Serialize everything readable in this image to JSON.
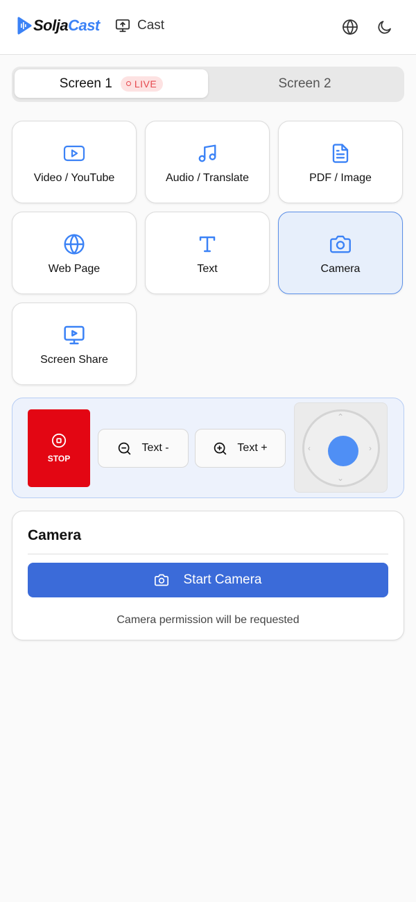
{
  "header": {
    "logo_part1": "Solja",
    "logo_part2": "Cast",
    "cast_label": "Cast",
    "brand_color": "#3b82f6"
  },
  "tabs": [
    {
      "label": "Screen 1",
      "badge": "LIVE",
      "active": true
    },
    {
      "label": "Screen 2",
      "active": false
    }
  ],
  "sources": [
    {
      "label": "Video / YouTube",
      "icon": "video-icon"
    },
    {
      "label": "Audio / Translate",
      "icon": "music-icon"
    },
    {
      "label": "PDF / Image",
      "icon": "file-text-icon"
    },
    {
      "label": "Web Page",
      "icon": "globe-icon"
    },
    {
      "label": "Text",
      "icon": "text-icon"
    },
    {
      "label": "Camera",
      "icon": "camera-icon",
      "active": true
    },
    {
      "label": "Screen Share",
      "icon": "monitor-icon"
    }
  ],
  "controls": {
    "stop_label": "STOP",
    "text_minus_label": "Text -",
    "text_plus_label": "Text +",
    "stop_color": "#e30613",
    "joystick_color": "#4f8ff5"
  },
  "panel": {
    "title": "Camera",
    "start_label": "Start Camera",
    "note": "Camera permission will be requested",
    "button_color": "#3b6bd9"
  }
}
